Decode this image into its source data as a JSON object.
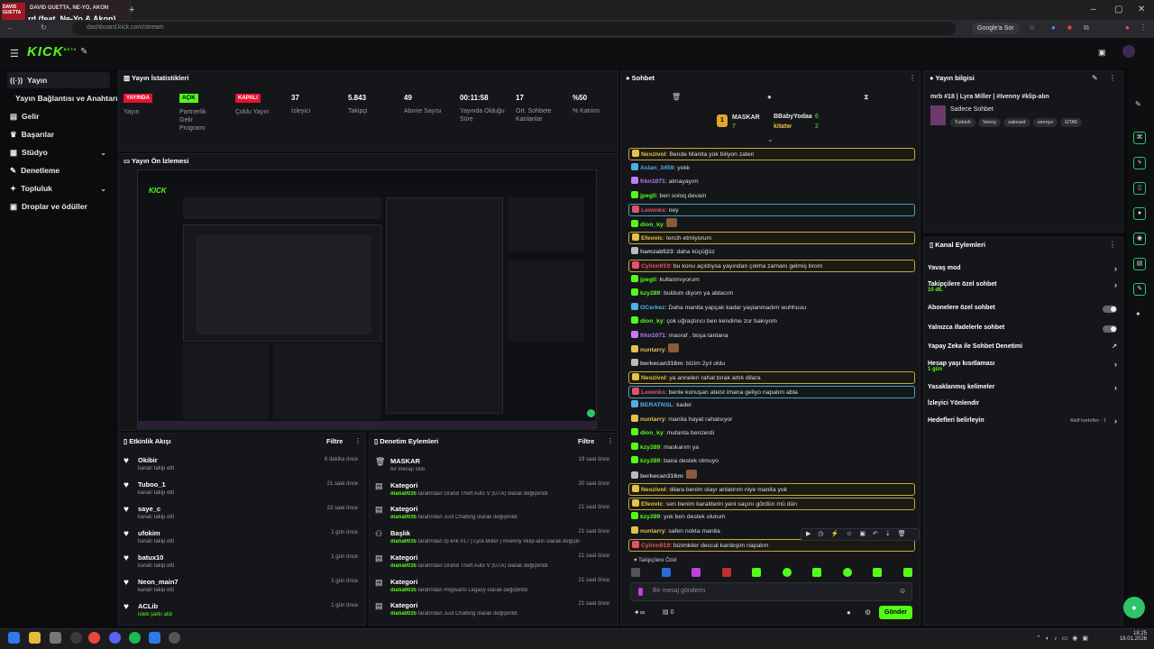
{
  "browser": {
    "media_artist": "DAVID GUETTA, NE-YO, AKON",
    "media_title": "rd (feat. Ne-Yo & Akon)",
    "media_thumb_text": "DAVID GUETTA",
    "address": "dashboard.kick.com/stream",
    "google_btn": "Google'a Sor"
  },
  "header": {
    "logo": "KICK",
    "logo_beta": "BETA"
  },
  "sidebar": {
    "items": [
      {
        "label": "Yayın",
        "icon": "broadcast-icon",
        "active": true
      },
      {
        "label": "Yayın Bağlantısı ve Anahtarı",
        "icon": "",
        "active": false
      },
      {
        "label": "Gelir",
        "icon": "wallet-icon"
      },
      {
        "label": "Başarılar",
        "icon": "trophy-icon"
      },
      {
        "label": "Stüdyo",
        "icon": "studio-icon",
        "chevron": true
      },
      {
        "label": "Denetleme",
        "icon": "wrench-icon"
      },
      {
        "label": "Topluluk",
        "icon": "community-icon",
        "chevron": true
      },
      {
        "label": "Droplar ve ödüller",
        "icon": "gift-icon"
      }
    ]
  },
  "stats": {
    "title": "Yayın İstatistikleri",
    "items": [
      {
        "value": "YAYINDA",
        "label": "Yayın",
        "badge_color": "#e8112d"
      },
      {
        "value": "AÇIK",
        "label": "Partnerlik Gelir Programı",
        "badge_color": "#53fc18"
      },
      {
        "value": "KAPALI",
        "label": "Çoklu Yayın",
        "badge_color": "#e8112d"
      },
      {
        "value": "37",
        "label": "İzleyici"
      },
      {
        "value": "5.843",
        "label": "Takipçi"
      },
      {
        "value": "49",
        "label": "Abone Sayısı"
      },
      {
        "value": "00:11:58",
        "label": "Yayında Olduğu Süre"
      },
      {
        "value": "17",
        "label": "Ort. Sohbete Katılanlar"
      },
      {
        "value": "%50",
        "label": "% Katılım"
      }
    ]
  },
  "preview": {
    "title": "Yayın Ön İzlemesi"
  },
  "activity": {
    "title": "Etkinlik Akışı",
    "filter": "Filtre",
    "rows": [
      {
        "name": "Okibir",
        "sub": "kanalı takip etti",
        "time": "6 dakika önce"
      },
      {
        "name": "Tuboo_1",
        "sub": "kanalı takip etti",
        "time": "21 saat önce"
      },
      {
        "name": "saye_c",
        "sub": "kanalı takip etti",
        "time": "23 saat önce"
      },
      {
        "name": "ufokim",
        "sub": "kanalı takip etti",
        "time": "1 gün önce"
      },
      {
        "name": "batux10",
        "sub": "kanalı takip etti",
        "time": "1 gün önce"
      },
      {
        "name": "Neon_main7",
        "sub": "kanalı takip etti",
        "time": "1 gün önce"
      },
      {
        "name": "ACLib",
        "sub": "istek şarkı aldı",
        "time": "1 gün önce"
      }
    ]
  },
  "moderation": {
    "title": "Denetim Eylemleri",
    "filter": "Filtre",
    "rows": [
      {
        "name": "MASKAR",
        "who": "",
        "sub": "bir mesajı sildi",
        "time": "19 saat önce"
      },
      {
        "name": "Kategori",
        "who": "diana0035",
        "sub": "tarafından Grand Theft Auto V (GTA) olarak değiştirildi",
        "time": "20 saat önce"
      },
      {
        "name": "Kategori",
        "who": "diana0035",
        "sub": "tarafından Just Chatting olarak değiştirildi",
        "time": "21 saat önce"
      },
      {
        "name": "Başlık",
        "who": "diana0035",
        "sub": "tarafından rp knk #17 | Lyra Miller | #Ivenny #klip-alın olarak değiştirildi",
        "time": "21 saat önce"
      },
      {
        "name": "Kategori",
        "who": "diana0035",
        "sub": "tarafından Grand Theft Auto V (GTA) olarak değiştirildi",
        "time": "21 saat önce"
      },
      {
        "name": "Kategori",
        "who": "diana0035",
        "sub": "tarafından Hogwarts Legacy olarak değiştirildi",
        "time": "21 saat önce"
      },
      {
        "name": "Kategori",
        "who": "diana0035",
        "sub": "tarafından Just Chatting olarak değiştirildi",
        "time": "21 saat önce"
      }
    ]
  },
  "chat": {
    "title": "Sohbet",
    "leader1_name": "MASKAR",
    "leader1_count": "7",
    "leader2_name": "BBabyYodaa",
    "leader2_count": "6",
    "leader3_name": "kitatw",
    "leader3_count": "2",
    "messages": [
      {
        "user": "Nexzivol",
        "text": "Bende Manita yok biliyon zaten",
        "color": "#e2c24a",
        "style": "hl"
      },
      {
        "user": "Aslan_3459",
        "text": "yokk",
        "color": "#4ab0e8"
      },
      {
        "user": "frkn1071",
        "text": "almayayım",
        "color": "#c27cf5"
      },
      {
        "user": "jpeg0",
        "text": "ben soloq devam",
        "color": "#53fc18"
      },
      {
        "user": "Lewinks",
        "text": "ney",
        "color": "#e84f6f",
        "style": "hb"
      },
      {
        "user": "dion_ky",
        "text": "",
        "color": "#53fc18"
      },
      {
        "user": "Efeovic",
        "text": "tercih etmiyorum",
        "color": "#e2c24a",
        "style": "hl"
      },
      {
        "user": "hamzab523",
        "text": "daha küçüğüz",
        "color": "#bbbbbb"
      },
      {
        "user": "Cylinn919",
        "text": "bu konu açıldıysa yayından çıkma zamanı gelmiş brom",
        "color": "#e84f6f",
        "style": "hl"
      },
      {
        "user": "jpeg0",
        "text": "kullanmıyorum",
        "color": "#53fc18"
      },
      {
        "user": "kzy289",
        "text": "buldum diyom ya ablacım",
        "color": "#53fc18"
      },
      {
        "user": "OCerkez",
        "text": "Daha manita yapçak kadar yaşlanmadım wuhhuuu",
        "color": "#4ab0e8"
      },
      {
        "user": "dion_ky",
        "text": "çok uğraştırıcı ben kendime zor bakıyom",
        "color": "#53fc18"
      },
      {
        "user": "frkn1071",
        "text": "masraf , boşa tantana",
        "color": "#c27cf5"
      },
      {
        "user": "nuntarry",
        "text": "",
        "color": "#e2c24a"
      },
      {
        "user": "berkecan316m",
        "text": "bizim 2yıl oldu",
        "color": "#bbbbbb"
      },
      {
        "user": "Nexzivol",
        "text": "ya anneleri rahat bırak artık dilara",
        "color": "#e2c24a",
        "style": "hl"
      },
      {
        "user": "Lewinks",
        "text": "benle konuşan ateist imana geliyo napalım abla",
        "color": "#e84f6f",
        "style": "hb"
      },
      {
        "user": "BERATNSL",
        "text": "kader",
        "color": "#4ab0e8"
      },
      {
        "user": "nuntarry",
        "text": "manita hayat rahatsıyor",
        "color": "#e2c24a"
      },
      {
        "user": "dion_ky",
        "text": "mutanta benzerdi",
        "color": "#53fc18"
      },
      {
        "user": "kzy289",
        "text": "maskarım ya",
        "color": "#53fc18"
      },
      {
        "user": "kzy289",
        "text": "bana destek olmuyo",
        "color": "#53fc18"
      },
      {
        "user": "berkecan316m",
        "text": "",
        "color": "#bbbbbb"
      },
      {
        "user": "Nexzivol",
        "text": "dilara benim olayı anlatırım niye manita yok",
        "color": "#e2c24a",
        "style": "hl"
      },
      {
        "user": "Efeovic",
        "text": "sen benim karakterin yeni saçını gördün mü dün",
        "color": "#e2c24a",
        "style": "hl"
      },
      {
        "user": "kzy289",
        "text": "yok ben destek olurum",
        "color": "#53fc18"
      },
      {
        "user": "nuntarry",
        "text": "safen nokta manita",
        "color": "#e2c24a"
      },
      {
        "user": "Cylinn919",
        "text": "bizimkiler deccal kardeşim napalım",
        "color": "#e84f6f",
        "style": "hl"
      }
    ],
    "mode_label": "Takipçilere Özel",
    "input_placeholder": "Bir mesaj gönderin",
    "points_value": "0",
    "send_label": "Gönder"
  },
  "stream_info": {
    "title": "Yayın bilgisi",
    "stream_title": "mrb #18 | Lyra Miller | #Ivenny #klip-alın",
    "category": "Sadece Sohbet",
    "tags": [
      "Turkish",
      "Venny",
      "valorant",
      "vennyv",
      "GTA5"
    ]
  },
  "channel_actions": {
    "title": "Kanal Eylemleri",
    "rows": [
      {
        "label": "Yavaş mod",
        "sub": "",
        "control": "chevron"
      },
      {
        "label": "Takipçilere özel sohbet",
        "sub": "10 dk.",
        "control": "chevron"
      },
      {
        "label": "Abonelere özel sohbet",
        "sub": "",
        "control": "toggle"
      },
      {
        "label": "Yalnızca ifadelerle sohbet",
        "sub": "",
        "control": "toggle"
      },
      {
        "label": "Yapay Zeka ile Sohbet Denetimi",
        "sub": "",
        "control": "external"
      },
      {
        "label": "Hesap yaşı kısıtlaması",
        "sub": "1 gün",
        "control": "chevron"
      },
      {
        "label": "Yasaklanmış kelimeler",
        "sub": "",
        "control": "chevron"
      },
      {
        "label": "İzleyici Yönlendir",
        "sub": "",
        "control": "none"
      },
      {
        "label": "Hedefleri belirleyin",
        "sub": "",
        "control": "chevron",
        "status": "Aktif hedefler - 1"
      }
    ]
  },
  "taskbar": {
    "time": "18:25",
    "date": "18.01.2026"
  },
  "colors": {
    "accent": "#53fc18",
    "live": "#e8112d",
    "panel": "#15161a",
    "bg": "#0b0c0e"
  }
}
